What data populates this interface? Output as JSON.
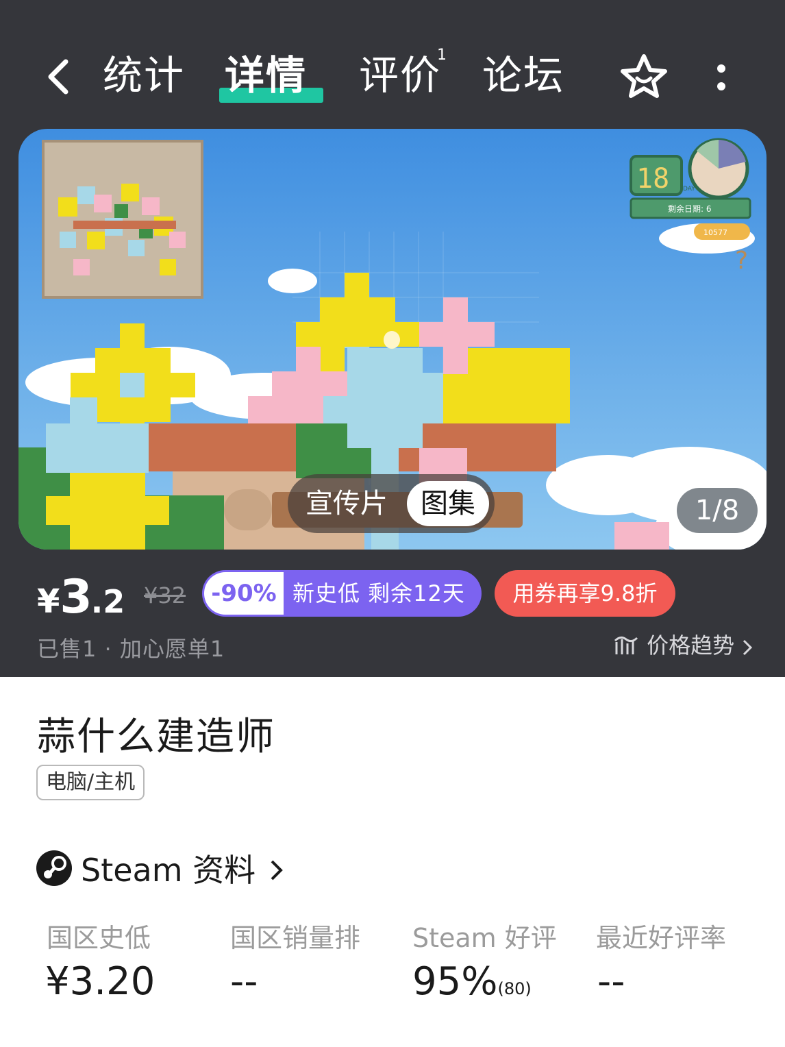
{
  "nav": {
    "tabs": [
      {
        "label": "统计"
      },
      {
        "label": "详情",
        "active": true
      },
      {
        "label": "评价",
        "badge": "1"
      },
      {
        "label": "论坛"
      }
    ],
    "icons": [
      "back-icon",
      "star-icon",
      "more-icon"
    ]
  },
  "media": {
    "toggle_video": "宣传片",
    "toggle_gallery": "图集",
    "counter": "1/8",
    "game_hud": {
      "day": "18",
      "day_label": "DAY",
      "deadline": "剩余日期: 6",
      "coins": "10577"
    }
  },
  "price": {
    "currency": "¥",
    "integer": "3",
    "decimal": ".2",
    "original": "¥32",
    "discount": "-90%",
    "discount_note": "新史低  剩余12天",
    "coupon": "用券再享9.8折",
    "sold_info": "已售1  ·  加心愿单1",
    "trend_label": "价格趋势"
  },
  "game": {
    "title": "蒜什么建造师",
    "platform": "电脑/主机"
  },
  "steam": {
    "section_label": "Steam 资料",
    "stats": [
      {
        "label": "国区史低",
        "value": "¥3.20"
      },
      {
        "label": "国区销量排",
        "value": "--"
      },
      {
        "label": "Steam 好评",
        "value": "95%",
        "count": "(80)"
      },
      {
        "label": "最近好评率",
        "value": "--"
      }
    ]
  },
  "colors": {
    "header_bg": "#35363b",
    "tab_accent": "#1fc6a2",
    "discount_purple": "#7c63f0",
    "coupon_red": "#f25a54"
  }
}
